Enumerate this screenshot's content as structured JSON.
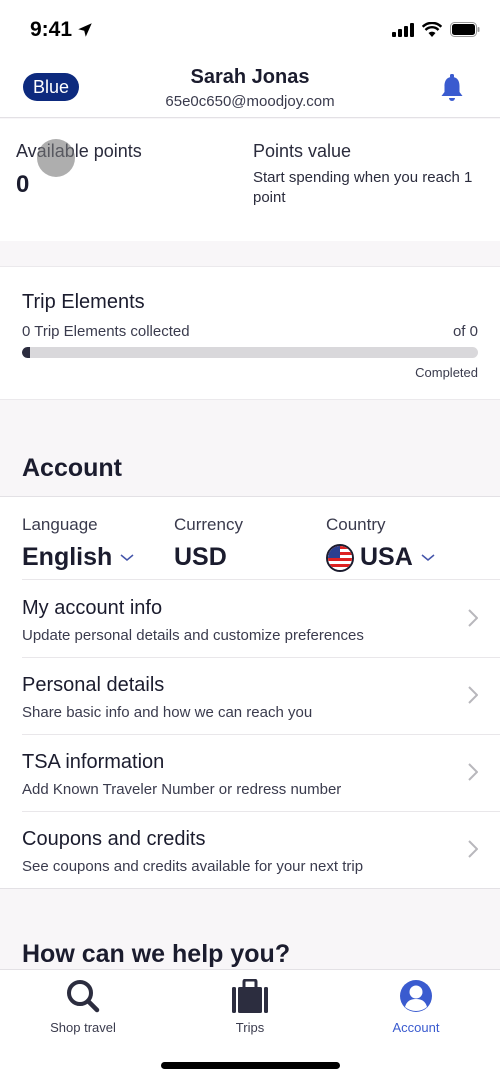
{
  "status_bar": {
    "time": "9:41",
    "icons": [
      "location-arrow-icon",
      "signal-icon",
      "wifi-icon",
      "battery-icon"
    ]
  },
  "header": {
    "tier_badge": "Blue",
    "name": "Sarah Jonas",
    "email": "65e0c650@moodjoy.com",
    "notification_icon": "bell-icon"
  },
  "colors": {
    "brand_dark": "#0d2a7e",
    "accent_blue": "#3a5bcf",
    "text_primary": "#1b1c2e",
    "page_bg": "#f8f6f8"
  },
  "points": {
    "available_label": "Available points",
    "available_value": "0",
    "value_label": "Points value",
    "value_text": "Start spending when you reach 1 point"
  },
  "trip_elements": {
    "title": "Trip Elements",
    "collected_text": "0 Trip Elements collected",
    "of_text": "of 0",
    "progress_fraction": 0,
    "completed_label": "Completed"
  },
  "account": {
    "heading": "Account",
    "preferences": [
      {
        "label": "Language",
        "value": "English",
        "has_dropdown": true
      },
      {
        "label": "Currency",
        "value": "USD",
        "has_dropdown": false
      },
      {
        "label": "Country",
        "value": "USA",
        "has_dropdown": true,
        "icon": "us-flag-icon"
      }
    ],
    "menu": [
      {
        "title": "My account info",
        "subtitle": "Update personal details and customize preferences"
      },
      {
        "title": "Personal details",
        "subtitle": "Share basic info and how we can reach you"
      },
      {
        "title": "TSA information",
        "subtitle": "Add Known Traveler Number or redress number"
      },
      {
        "title": "Coupons and credits",
        "subtitle": "See coupons and credits available for your next trip"
      }
    ]
  },
  "help": {
    "heading": "How can we help you?"
  },
  "tabbar": {
    "tabs": [
      {
        "label": "Shop travel",
        "icon": "search-icon",
        "active": false
      },
      {
        "label": "Trips",
        "icon": "suitcase-icon",
        "active": false
      },
      {
        "label": "Account",
        "icon": "account-icon",
        "active": true
      }
    ]
  }
}
